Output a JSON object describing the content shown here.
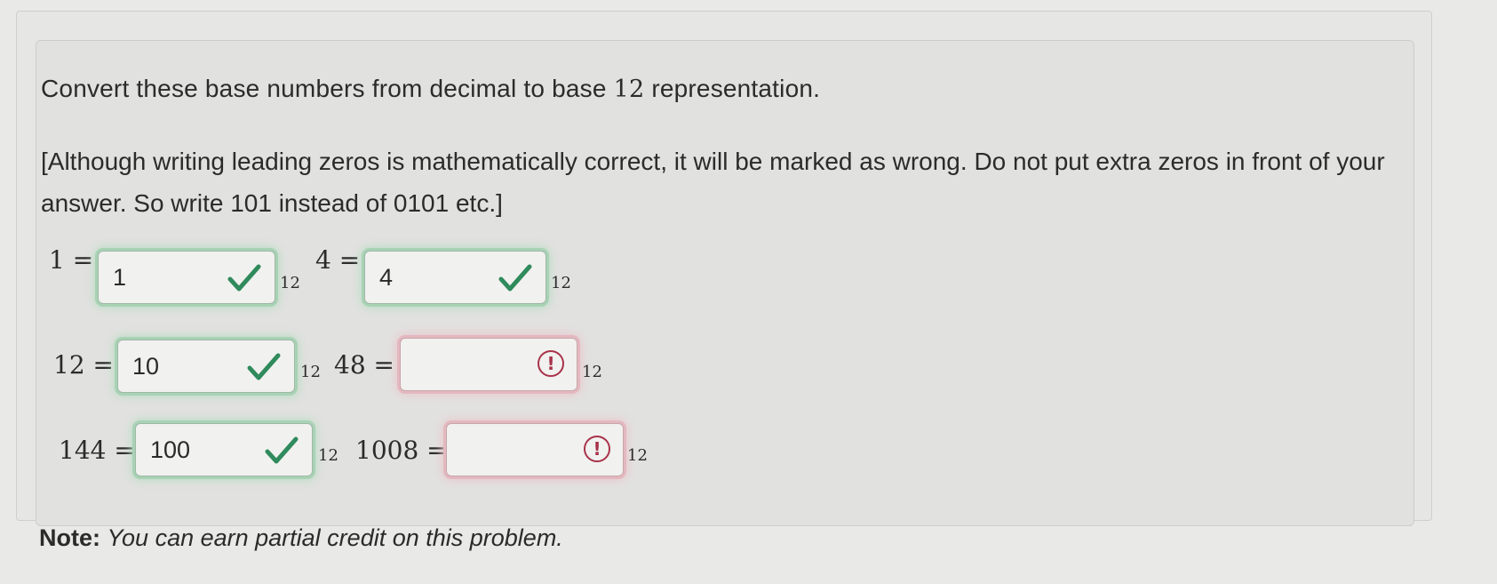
{
  "prompt": {
    "text_before": "Convert these base numbers from decimal to base ",
    "base": "12",
    "text_after": " representation."
  },
  "instructions": "[Although writing leading zeros is mathematically correct, it will be marked as wrong. Do not put extra zeros in front of your answer. So write 101 instead of 0101 etc.]",
  "rows": [
    {
      "left": {
        "lhs": "1",
        "eq": "=",
        "answer": "1",
        "status": "correct",
        "base": "12"
      },
      "right": {
        "lhs": "4",
        "eq": "=",
        "answer": "4",
        "status": "correct",
        "base": "12"
      }
    },
    {
      "left": {
        "lhs": "12",
        "eq": "=",
        "answer": "10",
        "status": "correct",
        "base": "12"
      },
      "right": {
        "lhs": "48",
        "eq": "=",
        "answer": "",
        "status": "incorrect",
        "base": "12"
      }
    },
    {
      "left": {
        "lhs": "144",
        "eq": "=",
        "answer": "100",
        "status": "correct",
        "base": "12"
      },
      "right": {
        "lhs": "1008",
        "eq": "=",
        "answer": "",
        "status": "incorrect",
        "base": "12"
      }
    }
  ],
  "warning_glyph": "!",
  "note": {
    "label": "Note:",
    "text": "You can earn partial credit on this problem."
  },
  "colors": {
    "correct": "#2f8a5c",
    "incorrect": "#a8324a"
  }
}
